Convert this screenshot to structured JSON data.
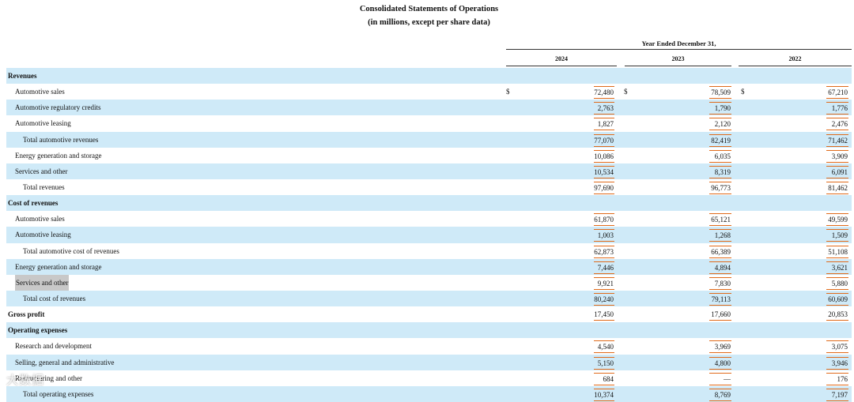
{
  "header": {
    "title": "Consolidated Statements of Operations",
    "subtitle": "(in millions, except per share data)",
    "period_label": "Year Ended December 31,",
    "years": [
      "2024",
      "2023",
      "2022"
    ],
    "currency_symbol": "$"
  },
  "rows": [
    {
      "label": "Revenues",
      "level": 0,
      "shade": true,
      "values": [
        "",
        "",
        ""
      ]
    },
    {
      "label": "Automotive sales",
      "level": 1,
      "shade": false,
      "values": [
        "72,480",
        "78,509",
        "67,210"
      ],
      "currency": true
    },
    {
      "label": "Automotive regulatory credits",
      "level": 1,
      "shade": true,
      "values": [
        "2,763",
        "1,790",
        "1,776"
      ]
    },
    {
      "label": "Automotive leasing",
      "level": 1,
      "shade": false,
      "values": [
        "1,827",
        "2,120",
        "2,476"
      ]
    },
    {
      "label": "Total automotive revenues",
      "level": 2,
      "shade": true,
      "values": [
        "77,070",
        "82,419",
        "71,462"
      ]
    },
    {
      "label": "Energy generation and storage",
      "level": 1,
      "shade": false,
      "values": [
        "10,086",
        "6,035",
        "3,909"
      ]
    },
    {
      "label": "Services and other",
      "level": 1,
      "shade": true,
      "values": [
        "10,534",
        "8,319",
        "6,091"
      ]
    },
    {
      "label": "Total revenues",
      "level": 2,
      "shade": false,
      "values": [
        "97,690",
        "96,773",
        "81,462"
      ]
    },
    {
      "label": "Cost of revenues",
      "level": 0,
      "shade": true,
      "values": [
        "",
        "",
        ""
      ]
    },
    {
      "label": "Automotive sales",
      "level": 1,
      "shade": false,
      "values": [
        "61,870",
        "65,121",
        "49,599"
      ]
    },
    {
      "label": "Automotive leasing",
      "level": 1,
      "shade": true,
      "values": [
        "1,003",
        "1,268",
        "1,509"
      ]
    },
    {
      "label": "Total automotive cost of revenues",
      "level": 2,
      "shade": false,
      "values": [
        "62,873",
        "66,389",
        "51,108"
      ]
    },
    {
      "label": "Energy generation and storage",
      "level": 1,
      "shade": true,
      "values": [
        "7,446",
        "4,894",
        "3,621"
      ]
    },
    {
      "label": "Services and other",
      "level": 1,
      "shade": false,
      "values": [
        "9,921",
        "7,830",
        "5,880"
      ],
      "highlight": true
    },
    {
      "label": "Total cost of revenues",
      "level": 2,
      "shade": true,
      "values": [
        "80,240",
        "79,113",
        "60,609"
      ]
    },
    {
      "label": "Gross profit",
      "level": 0,
      "shade": false,
      "values": [
        "17,450",
        "17,660",
        "20,853"
      ]
    },
    {
      "label": "Operating expenses",
      "level": 0,
      "shade": true,
      "values": [
        "",
        "",
        ""
      ]
    },
    {
      "label": "Research and development",
      "level": 1,
      "shade": false,
      "values": [
        "4,540",
        "3,969",
        "3,075"
      ]
    },
    {
      "label": "Selling, general and administrative",
      "level": 1,
      "shade": true,
      "values": [
        "5,150",
        "4,800",
        "3,946"
      ]
    },
    {
      "label": "Restructuring and other",
      "level": 1,
      "shade": false,
      "values": [
        "684",
        "—",
        "176"
      ]
    },
    {
      "label": "Total operating expenses",
      "level": 2,
      "shade": true,
      "values": [
        "10,374",
        "8,769",
        "7,197"
      ]
    }
  ],
  "watermark": "大数据"
}
